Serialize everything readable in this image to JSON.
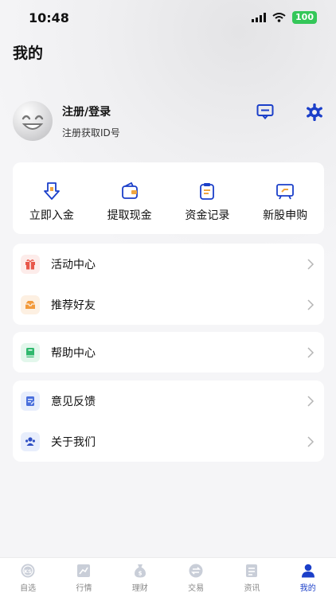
{
  "status_bar": {
    "time": "10:48",
    "battery": "100"
  },
  "header": {
    "title": "我的"
  },
  "profile": {
    "name": "注册/登录",
    "subtitle": "注册获取ID号"
  },
  "quick_actions": [
    {
      "label": "立即入金",
      "icon": "deposit-icon"
    },
    {
      "label": "提取现金",
      "icon": "wallet-icon"
    },
    {
      "label": "资金记录",
      "icon": "clipboard-icon"
    },
    {
      "label": "新股申购",
      "icon": "presentation-icon"
    }
  ],
  "menu_groups": [
    [
      {
        "label": "活动中心",
        "icon": "gift-icon"
      },
      {
        "label": "推荐好友",
        "icon": "mailbox-icon"
      }
    ],
    [
      {
        "label": "帮助中心",
        "icon": "book-icon"
      }
    ],
    [
      {
        "label": "意见反馈",
        "icon": "feedback-icon"
      },
      {
        "label": "关于我们",
        "icon": "people-icon"
      }
    ]
  ],
  "tabs": [
    {
      "label": "自选",
      "icon": "ks-coin-icon"
    },
    {
      "label": "行情",
      "icon": "chart-icon"
    },
    {
      "label": "理财",
      "icon": "money-bag-icon"
    },
    {
      "label": "交易",
      "icon": "exchange-icon"
    },
    {
      "label": "资讯",
      "icon": "news-icon"
    },
    {
      "label": "我的",
      "icon": "person-icon",
      "active": true
    }
  ],
  "colors": {
    "accent": "#1b3fc9",
    "background": "#f5f5f7",
    "battery": "#34c759"
  }
}
